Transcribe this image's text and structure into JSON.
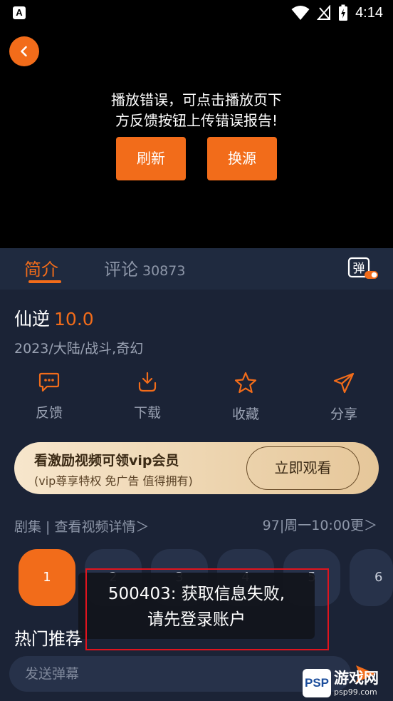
{
  "status_bar": {
    "time": "4:14",
    "left_icon": "A"
  },
  "player": {
    "error_message": "播放错误，可点击播放页下\n方反馈按钮上传错误报告!",
    "refresh_label": "刷新",
    "switch_source_label": "换源"
  },
  "tabs": {
    "intro": "简介",
    "comments": "评论",
    "comment_count": "30873",
    "danmu_icon": "弹"
  },
  "show": {
    "title": "仙逆",
    "rating": "10.0",
    "tags": "2023/大陆/战斗,奇幻"
  },
  "actions": [
    {
      "label": "反馈",
      "icon": "comment-icon"
    },
    {
      "label": "下载",
      "icon": "download-icon"
    },
    {
      "label": "收藏",
      "icon": "star-icon"
    },
    {
      "label": "分享",
      "icon": "share-icon"
    }
  ],
  "vip_banner": {
    "title": "看激励视频可领vip会员",
    "subtitle": "(vip尊享特权 免广告 值得拥有)",
    "button": "立即观看"
  },
  "episodes": {
    "header": "剧集 | 查看视频详情＞",
    "update_info": "97|周一10:00更＞",
    "items": [
      "1",
      "2",
      "3",
      "4",
      "5",
      "6"
    ],
    "active": "1"
  },
  "hot_recommend": "热门推荐",
  "danmu_input": {
    "placeholder": "发送弹幕"
  },
  "toast": {
    "message": "500403: 获取信息失败,\n请先登录账户"
  },
  "watermark": {
    "badge": "PSP",
    "site": "游戏网",
    "url": "psp99.com"
  },
  "colors": {
    "accent": "#f26c1a",
    "background": "#1b2336",
    "toast_border": "#e0141e"
  }
}
